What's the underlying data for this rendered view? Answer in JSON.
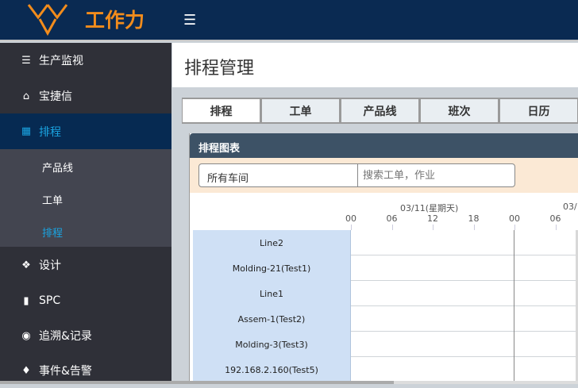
{
  "header": {
    "brand": "工作力",
    "menu_icon": "hamburger-icon",
    "brand_color": "#f28c1c"
  },
  "sidebar": {
    "items": [
      {
        "label": "生产监视",
        "icon": "layers-icon"
      },
      {
        "label": "宝捷信",
        "icon": "home-icon"
      },
      {
        "label": "排程",
        "icon": "grid-icon",
        "active": true
      },
      {
        "label": "设计",
        "icon": "tag-icon"
      },
      {
        "label": "SPC",
        "icon": "bar-chart-icon"
      },
      {
        "label": "追溯&记录",
        "icon": "eye-icon"
      },
      {
        "label": "事件&告警",
        "icon": "bell-icon"
      }
    ],
    "subitems": [
      {
        "label": "产品线"
      },
      {
        "label": "工单"
      },
      {
        "label": "排程",
        "active": true
      }
    ]
  },
  "page": {
    "title": "排程管理"
  },
  "tabs": [
    {
      "label": "排程",
      "active": true
    },
    {
      "label": "工单"
    },
    {
      "label": "产品线"
    },
    {
      "label": "班次"
    },
    {
      "label": "日历"
    }
  ],
  "panel": {
    "title": "排程图表",
    "workshop_select": "所有车间",
    "search_placeholder": "搜索工单，作业"
  },
  "timeline": {
    "dates": [
      "03/11(星期天)",
      "03/"
    ],
    "ticks": [
      "00",
      "06",
      "12",
      "18",
      "00",
      "06"
    ],
    "rows": [
      "Line2",
      "Molding-21(Test1)",
      "Line1",
      "Assem-1(Test2)",
      "Molding-3(Test3)",
      "192.168.2.160(Test5)"
    ]
  }
}
